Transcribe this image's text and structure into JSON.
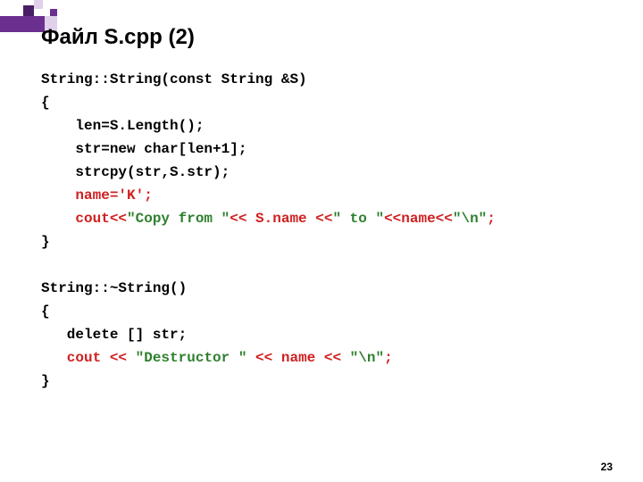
{
  "title": "Файл S.cpp (2)",
  "page_number": "23",
  "code": {
    "l1": "String::String(const String &S)",
    "l2": "{",
    "l3": "    len=S.Length();",
    "l4": "    str=new char[len+1];",
    "l5": "    strcpy(str,S.str);",
    "l6": "    name='K';",
    "l7a": "    cout<<",
    "l7b": "\"Copy from \"",
    "l7c": "<< S.name <<",
    "l7d": "\" to \"",
    "l7e": "<<name<<",
    "l7f": "\"\\n\"",
    "l7g": ";",
    "l8": "}",
    "blank1": " ",
    "l9": "String::~String()",
    "l10": "{",
    "l11": "   delete [] str;",
    "l12a": "   cout << ",
    "l12b": "\"Destructor \"",
    "l12c": " << name << ",
    "l12d": "\"\\n\"",
    "l12e": ";",
    "l13": "}"
  },
  "colors": {
    "accent": "#6b2f8f",
    "accent_light": "#c9a6e0",
    "red": "#d02020",
    "green": "#2f7f2f"
  }
}
